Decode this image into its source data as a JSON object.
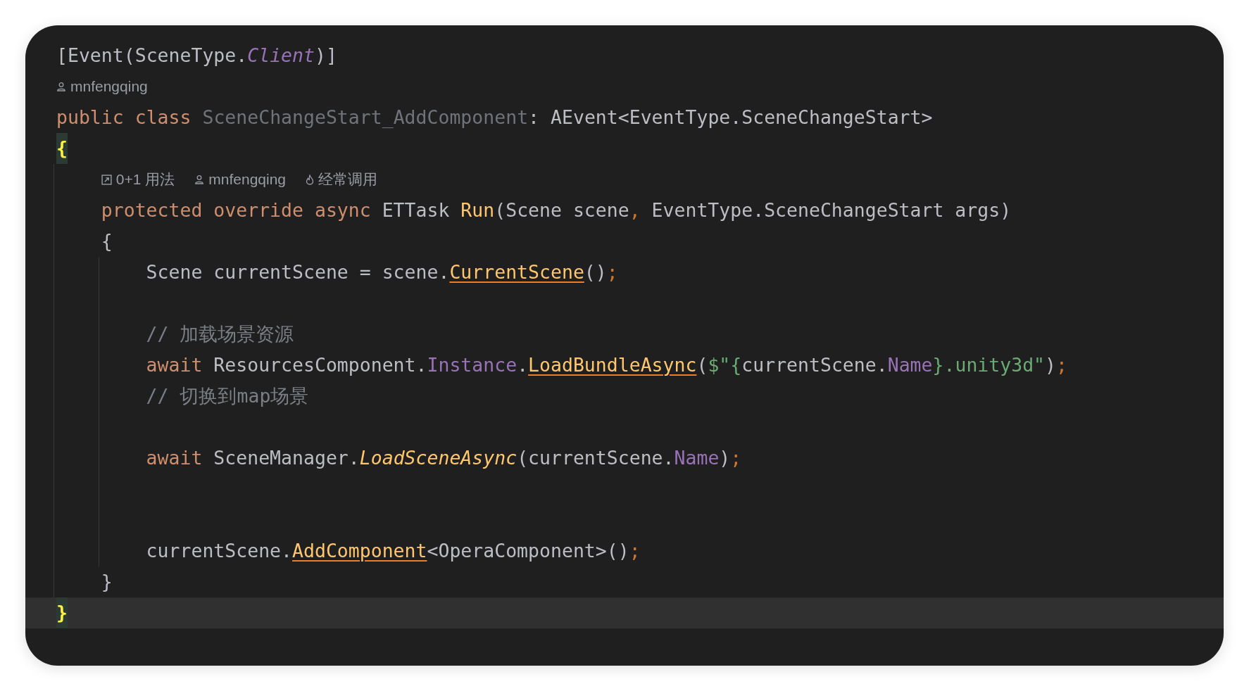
{
  "editor": {
    "lines": [
      {
        "kind": "code",
        "tokens": [
          {
            "text": "[Event(SceneType.",
            "kind": "plain"
          },
          {
            "text": "Client",
            "kind": "member-italic"
          },
          {
            "text": ")]",
            "kind": "plain"
          }
        ]
      },
      {
        "kind": "hint",
        "hints": [
          {
            "kind": "author",
            "text": "mnfengqing"
          }
        ]
      },
      {
        "kind": "code",
        "tokens": [
          {
            "text": "public class ",
            "kind": "keyword"
          },
          {
            "text": "SceneChangeStart_AddComponent",
            "kind": "unused"
          },
          {
            "text": ": AEvent<EventType.SceneChangeStart>",
            "kind": "plain"
          }
        ]
      },
      {
        "kind": "code",
        "tokens": [
          {
            "text": "{",
            "kind": "brace-match"
          }
        ],
        "children": [
          {
            "kind": "hint",
            "hints": [
              {
                "kind": "usages",
                "text": "0+1 用法"
              },
              {
                "kind": "author",
                "text": "mnfengqing"
              },
              {
                "kind": "frequent",
                "text": "经常调用"
              }
            ]
          },
          {
            "kind": "code",
            "tokens": [
              {
                "text": "protected override async ",
                "kind": "keyword"
              },
              {
                "text": "ETTask ",
                "kind": "plain"
              },
              {
                "text": "Run",
                "kind": "method"
              },
              {
                "text": "(Scene scene",
                "kind": "plain"
              },
              {
                "text": ", ",
                "kind": "punct"
              },
              {
                "text": "EventType.SceneChangeStart args)",
                "kind": "plain"
              }
            ]
          },
          {
            "kind": "code",
            "tokens": [
              {
                "text": "{",
                "kind": "plain"
              }
            ],
            "children": [
              {
                "kind": "code",
                "tokens": [
                  {
                    "text": "Scene currentScene = scene.",
                    "kind": "plain"
                  },
                  {
                    "text": "CurrentScene",
                    "kind": "method-link"
                  },
                  {
                    "text": "()",
                    "kind": "plain"
                  },
                  {
                    "text": ";",
                    "kind": "punct"
                  }
                ]
              },
              {
                "kind": "blank"
              },
              {
                "kind": "code",
                "tokens": [
                  {
                    "text": "// 加载场景资源",
                    "kind": "comment"
                  }
                ]
              },
              {
                "kind": "code",
                "tokens": [
                  {
                    "text": "await ",
                    "kind": "keyword"
                  },
                  {
                    "text": "ResourcesComponent.",
                    "kind": "plain"
                  },
                  {
                    "text": "Instance",
                    "kind": "member"
                  },
                  {
                    "text": ".",
                    "kind": "plain"
                  },
                  {
                    "text": "LoadBundleAsync",
                    "kind": "method-link"
                  },
                  {
                    "text": "(",
                    "kind": "plain"
                  },
                  {
                    "text": "$\"{",
                    "kind": "string"
                  },
                  {
                    "text": "currentScene.",
                    "kind": "plain"
                  },
                  {
                    "text": "Name",
                    "kind": "member"
                  },
                  {
                    "text": "}.unity3d\"",
                    "kind": "string"
                  },
                  {
                    "text": ")",
                    "kind": "plain"
                  },
                  {
                    "text": ";",
                    "kind": "punct"
                  }
                ]
              },
              {
                "kind": "code",
                "tokens": [
                  {
                    "text": "// 切换到map场景",
                    "kind": "comment"
                  }
                ]
              },
              {
                "kind": "blank"
              },
              {
                "kind": "code",
                "tokens": [
                  {
                    "text": "await ",
                    "kind": "keyword"
                  },
                  {
                    "text": "SceneManager.",
                    "kind": "plain"
                  },
                  {
                    "text": "LoadSceneAsync",
                    "kind": "method-italic"
                  },
                  {
                    "text": "(currentScene.",
                    "kind": "plain"
                  },
                  {
                    "text": "Name",
                    "kind": "member"
                  },
                  {
                    "text": ")",
                    "kind": "plain"
                  },
                  {
                    "text": ";",
                    "kind": "punct"
                  }
                ]
              },
              {
                "kind": "blank"
              },
              {
                "kind": "blank"
              },
              {
                "kind": "code",
                "tokens": [
                  {
                    "text": "currentScene.",
                    "kind": "plain"
                  },
                  {
                    "text": "AddComponent",
                    "kind": "method-link"
                  },
                  {
                    "text": "<OperaComponent>()",
                    "kind": "plain"
                  },
                  {
                    "text": ";",
                    "kind": "punct"
                  }
                ]
              }
            ]
          },
          {
            "kind": "code",
            "tokens": [
              {
                "text": "}",
                "kind": "plain"
              }
            ]
          }
        ]
      },
      {
        "kind": "code",
        "current": true,
        "tokens": [
          {
            "text": "}",
            "kind": "brace-match"
          }
        ]
      }
    ]
  }
}
